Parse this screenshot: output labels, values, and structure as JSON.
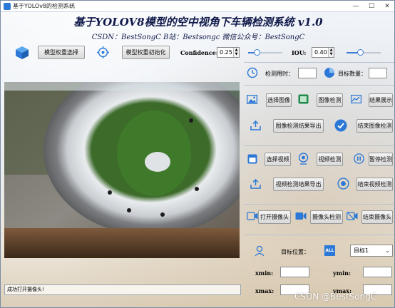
{
  "window": {
    "title": "基于YOLOv8的检测系统",
    "min_glyph": "—",
    "max_glyph": "☐",
    "close_glyph": "✕"
  },
  "header": {
    "title": "基于YOLOV8模型的空中视角下车辆检测系统 v1.0",
    "subtitle": "CSDN：BestSongC    B站：Bestsongc    微信公众号：BestSongC"
  },
  "toolbar": {
    "model_select_label": "模型权重选择",
    "model_init_label": "模型权重初始化",
    "confidence_label": "Confidence:",
    "confidence_value": "0.25",
    "confidence_level": 0.25,
    "iou_label": "IOU:",
    "iou_value": "0.40",
    "iou_level": 0.4
  },
  "info": {
    "detect_time_label": "检测用时：",
    "detect_time_value": "",
    "target_count_label": "目标数量：",
    "target_count_value": ""
  },
  "image_section": {
    "select_label": "选择图像",
    "detect_label": "图像检测",
    "show_result_label": "结果展示",
    "export_label": "图像检测结果导出",
    "end_label": "结束图像检测"
  },
  "video_section": {
    "select_label": "选择视频",
    "detect_label": "视频检测",
    "pause_label": "暂停检测",
    "export_label": "视频检测结果导出",
    "end_label": "结束视频检测"
  },
  "camera_section": {
    "open_label": "打开摄像头",
    "detect_label": "摄像头检测",
    "end_label": "结束摄像头"
  },
  "target": {
    "position_label": "目标位置：",
    "all_badge": "ALL",
    "selected": "目标1",
    "xmin_label": "xmin:",
    "ymin_label": "ymin:",
    "xmax_label": "xmax:",
    "ymax_label": "ymax:",
    "xmin_value": "",
    "ymin_value": "",
    "xmax_value": "",
    "ymax_value": ""
  },
  "status": {
    "message": "成功打开摄像头!"
  },
  "watermark": "CSDN @BestSongC",
  "colors": {
    "accent": "#2b78d6",
    "title_text": "#10194a"
  }
}
